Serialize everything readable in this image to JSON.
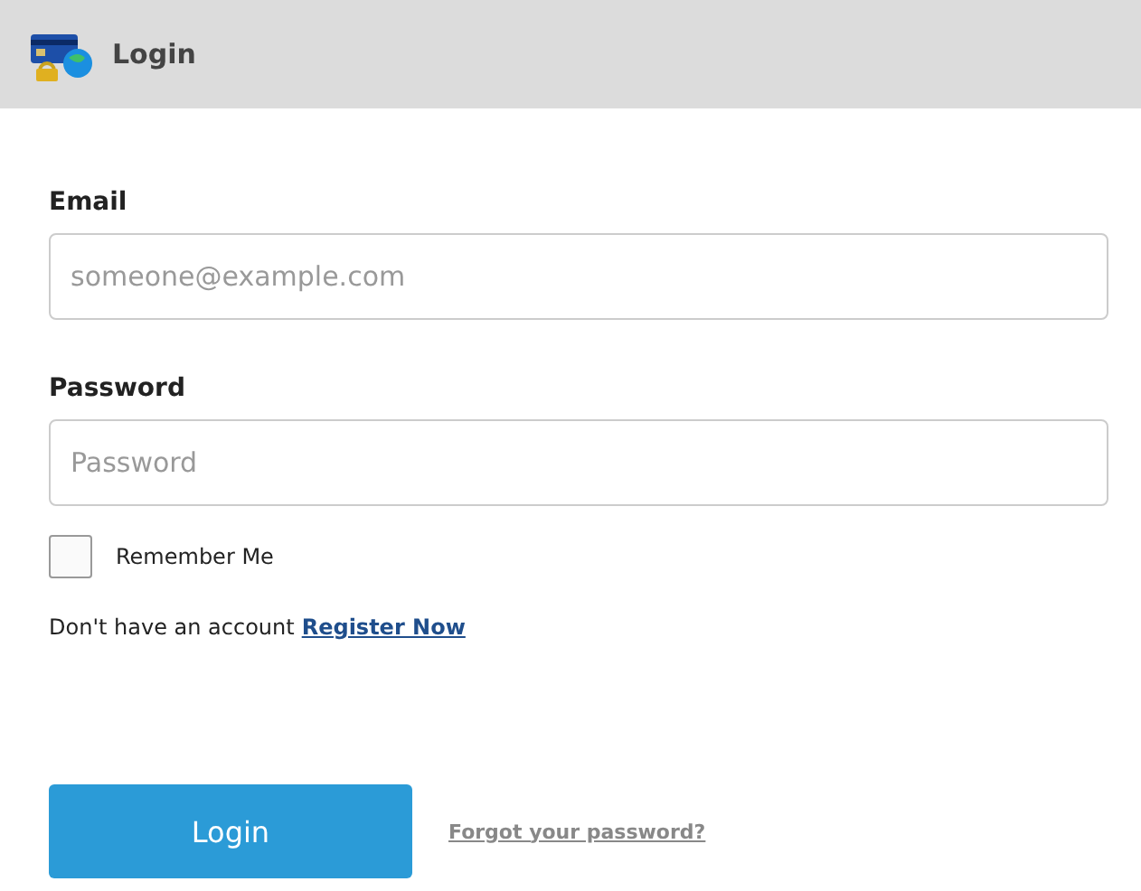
{
  "header": {
    "title": "Login"
  },
  "fields": [
    {
      "label": "Email",
      "placeholder": "someone@example.com"
    },
    {
      "label": "Password",
      "placeholder": "Password"
    }
  ],
  "remember": {
    "label": "Remember Me",
    "checked": false
  },
  "register": {
    "text": "Don't have an account",
    "link": "Register Now"
  },
  "login_button": "Login",
  "forgot_link": "Forgot your password?"
}
